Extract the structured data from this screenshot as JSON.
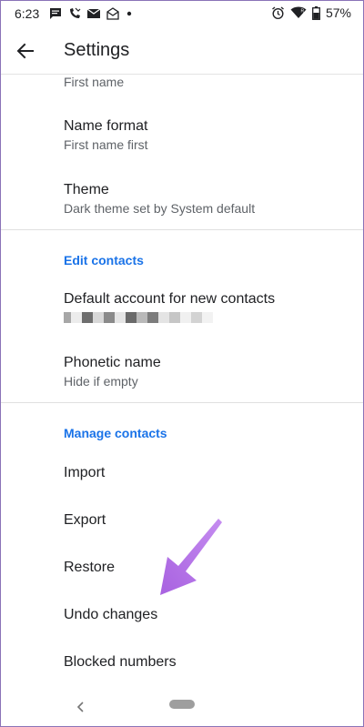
{
  "status_bar": {
    "time": "6:23",
    "left_icons": [
      "message-icon",
      "missed-call-icon",
      "mail-icon",
      "mail-open-icon",
      "dot-icon"
    ],
    "right_icons": [
      "alarm-icon",
      "wifi-icon",
      "battery-icon"
    ],
    "battery_percent": "57%"
  },
  "app_bar": {
    "title": "Settings"
  },
  "items": {
    "first_name": {
      "subtitle": "First name"
    },
    "name_format": {
      "title": "Name format",
      "subtitle": "First name first"
    },
    "theme": {
      "title": "Theme",
      "subtitle": "Dark theme set by System default"
    },
    "default_account": {
      "title": "Default account for new contacts"
    },
    "phonetic_name": {
      "title": "Phonetic name",
      "subtitle": "Hide if empty"
    },
    "import": {
      "title": "Import"
    },
    "export": {
      "title": "Export"
    },
    "restore": {
      "title": "Restore"
    },
    "undo_changes": {
      "title": "Undo changes"
    },
    "blocked_numbers": {
      "title": "Blocked numbers"
    }
  },
  "sections": {
    "edit_contacts": "Edit contacts",
    "manage_contacts": "Manage contacts"
  },
  "colors": {
    "accent": "#1a73e8",
    "annotation_arrow": "#b673e6"
  }
}
